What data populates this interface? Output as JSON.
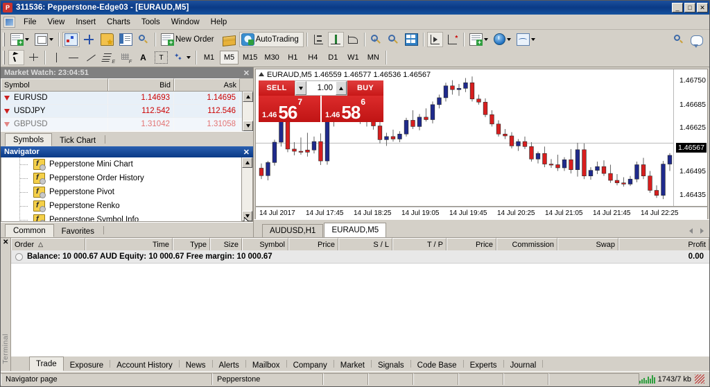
{
  "window": {
    "title": "311536: Pepperstone-Edge03 - [EURAUD,M5]",
    "app_icon": "P",
    "minimize": "_",
    "maximize": "□",
    "close": "✕"
  },
  "menu": [
    "File",
    "View",
    "Insert",
    "Charts",
    "Tools",
    "Window",
    "Help"
  ],
  "toolbar_main": {
    "new_chart": "new-chart-icon",
    "profiles": "profiles-icon",
    "market_watch": "market-watch-icon",
    "data_window": "data-window-icon",
    "navigator": "navigator-icon",
    "terminal": "terminal-icon",
    "strategy_tester": "strategy-tester-icon",
    "new_order_label": "New Order",
    "mqlcommunity": "mail-icon",
    "autotrading_label": "AutoTrading",
    "bar_chart": "bar-chart-icon",
    "candle_chart": "candlestick-chart-icon",
    "line_chart": "line-chart-icon",
    "zoom_in": "zoom-in-icon",
    "zoom_out": "zoom-out-icon",
    "tile_windows": "tile-windows-icon",
    "chart_shift": "chart-shift-icon",
    "auto_scroll": "auto-scroll-icon",
    "indicators": "indicators-icon",
    "periods": "periods-clock-icon",
    "templates": "templates-icon",
    "search": "search-icon",
    "chat": "chat-icon"
  },
  "toolbar_draw": {
    "cursor": "cursor-icon",
    "crosshair": "crosshair-icon",
    "vertical_line": "vertical-line-icon",
    "horizontal_line": "horizontal-line-icon",
    "trendline": "trendline-icon",
    "fibonacci": "fibonacci-icon",
    "shapes": "shapes-icon",
    "text_label": "text-label-icon",
    "text_box": "text-box-icon",
    "objects": "objects-icon"
  },
  "timeframes": {
    "items": [
      "M1",
      "M5",
      "M15",
      "M30",
      "H1",
      "H4",
      "D1",
      "W1",
      "MN"
    ],
    "selected": "M5"
  },
  "market_watch": {
    "title": "Market Watch: 23:04:51",
    "close": "✕",
    "columns": [
      "Symbol",
      "Bid",
      "Ask"
    ],
    "rows": [
      {
        "symbol": "EURUSD",
        "bid": "1.14693",
        "ask": "1.14695"
      },
      {
        "symbol": "USDJPY",
        "bid": "112.542",
        "ask": "112.546"
      },
      {
        "symbol": "GBPUSD",
        "bid": "1.31042",
        "ask": "1.31058"
      }
    ],
    "tabs": [
      "Symbols",
      "Tick Chart"
    ],
    "selected_tab": "Symbols"
  },
  "navigator": {
    "title": "Navigator",
    "close": "✕",
    "items": [
      "Pepperstone Mini Chart",
      "Pepperstone Order History",
      "Pepperstone Pivot",
      "Pepperstone Renko",
      "Pepperstone Symbol Info"
    ],
    "tabs": [
      "Common",
      "Favorites"
    ],
    "selected_tab": "Common"
  },
  "chart": {
    "header": "EURAUD,M5  1.46559 1.46577 1.46536 1.46567",
    "symbol": "EURAUD",
    "period": "M5",
    "ohlc": {
      "open": "1.46559",
      "high": "1.46577",
      "low": "1.46536",
      "close": "1.46567"
    },
    "one_click_trading": {
      "sell_label": "SELL",
      "buy_label": "BUY",
      "volume": "1.00",
      "sell_big_prefix": "1.46",
      "sell_big": "56",
      "sell_sup": "7",
      "buy_big_prefix": "1.46",
      "buy_big": "58",
      "buy_sup": "6",
      "dropdown_icon": "chevron-down-icon",
      "spinner_icon": "chevron-up-icon"
    },
    "price_labels": [
      "1.46750",
      "1.46685",
      "1.46625",
      "1.46495",
      "1.46435"
    ],
    "current_price": "1.46567",
    "time_labels": [
      "14 Jul 2017",
      "14 Jul 17:45",
      "14 Jul 18:25",
      "14 Jul 19:05",
      "14 Jul 19:45",
      "14 Jul 20:25",
      "14 Jul 21:05",
      "14 Jul 21:45",
      "14 Jul 22:25"
    ],
    "tabs": [
      "AUDUSD,H1",
      "EURAUD,M5"
    ],
    "selected_tab": "EURAUD,M5",
    "scroll_left_icon": "chevron-left-icon",
    "scroll_right_icon": "chevron-right-icon"
  },
  "chart_data": {
    "type": "candlestick",
    "title": "EURAUD,M5",
    "xlabel": "",
    "ylabel": "",
    "ylim": [
      1.464,
      1.4679
    ],
    "bull_color": "#1f2a8c",
    "bear_color": "#d81e1e",
    "candles": [
      {
        "o": 1.46487,
        "h": 1.46502,
        "l": 1.46452,
        "c": 1.46463,
        "dir": "down"
      },
      {
        "o": 1.46463,
        "h": 1.4651,
        "l": 1.46448,
        "c": 1.46505,
        "dir": "up"
      },
      {
        "o": 1.46505,
        "h": 1.46578,
        "l": 1.46495,
        "c": 1.4657,
        "dir": "up"
      },
      {
        "o": 1.4657,
        "h": 1.46645,
        "l": 1.46556,
        "c": 1.46638,
        "dir": "up"
      },
      {
        "o": 1.4664,
        "h": 1.46652,
        "l": 1.46538,
        "c": 1.46548,
        "dir": "down"
      },
      {
        "o": 1.46548,
        "h": 1.4657,
        "l": 1.46528,
        "c": 1.46541,
        "dir": "down"
      },
      {
        "o": 1.46541,
        "h": 1.46585,
        "l": 1.4653,
        "c": 1.46538,
        "dir": "down"
      },
      {
        "o": 1.46538,
        "h": 1.466,
        "l": 1.46524,
        "c": 1.46545,
        "dir": "down"
      },
      {
        "o": 1.46545,
        "h": 1.46588,
        "l": 1.46534,
        "c": 1.46572,
        "dir": "up"
      },
      {
        "o": 1.46572,
        "h": 1.46598,
        "l": 1.46497,
        "c": 1.4651,
        "dir": "down"
      },
      {
        "o": 1.4651,
        "h": 1.4666,
        "l": 1.46498,
        "c": 1.46648,
        "dir": "up"
      },
      {
        "o": 1.46648,
        "h": 1.46678,
        "l": 1.4662,
        "c": 1.46665,
        "dir": "up"
      },
      {
        "o": 1.46665,
        "h": 1.4669,
        "l": 1.4665,
        "c": 1.46672,
        "dir": "up"
      },
      {
        "o": 1.46672,
        "h": 1.46688,
        "l": 1.4664,
        "c": 1.46655,
        "dir": "down"
      },
      {
        "o": 1.46655,
        "h": 1.46692,
        "l": 1.46645,
        "c": 1.46678,
        "dir": "up"
      },
      {
        "o": 1.46678,
        "h": 1.467,
        "l": 1.46628,
        "c": 1.4664,
        "dir": "down"
      },
      {
        "o": 1.4664,
        "h": 1.46688,
        "l": 1.4662,
        "c": 1.46668,
        "dir": "up"
      },
      {
        "o": 1.46668,
        "h": 1.46695,
        "l": 1.4661,
        "c": 1.46622,
        "dir": "down"
      },
      {
        "o": 1.46622,
        "h": 1.4664,
        "l": 1.46566,
        "c": 1.46578,
        "dir": "down"
      },
      {
        "o": 1.46578,
        "h": 1.466,
        "l": 1.46558,
        "c": 1.46588,
        "dir": "up"
      },
      {
        "o": 1.46588,
        "h": 1.4661,
        "l": 1.46572,
        "c": 1.4658,
        "dir": "down"
      },
      {
        "o": 1.4658,
        "h": 1.46605,
        "l": 1.4657,
        "c": 1.46596,
        "dir": "up"
      },
      {
        "o": 1.46596,
        "h": 1.46648,
        "l": 1.46588,
        "c": 1.4664,
        "dir": "up"
      },
      {
        "o": 1.4664,
        "h": 1.46672,
        "l": 1.46612,
        "c": 1.4662,
        "dir": "down"
      },
      {
        "o": 1.4662,
        "h": 1.4666,
        "l": 1.46608,
        "c": 1.4665,
        "dir": "up"
      },
      {
        "o": 1.4665,
        "h": 1.46678,
        "l": 1.46636,
        "c": 1.46642,
        "dir": "down"
      },
      {
        "o": 1.46642,
        "h": 1.467,
        "l": 1.4663,
        "c": 1.4669,
        "dir": "up"
      },
      {
        "o": 1.4669,
        "h": 1.46722,
        "l": 1.46678,
        "c": 1.46712,
        "dir": "up"
      },
      {
        "o": 1.46712,
        "h": 1.4676,
        "l": 1.467,
        "c": 1.4675,
        "dir": "up"
      },
      {
        "o": 1.4675,
        "h": 1.46768,
        "l": 1.46722,
        "c": 1.46738,
        "dir": "down"
      },
      {
        "o": 1.46738,
        "h": 1.46756,
        "l": 1.46718,
        "c": 1.46742,
        "dir": "up"
      },
      {
        "o": 1.46742,
        "h": 1.46775,
        "l": 1.4673,
        "c": 1.4676,
        "dir": "up"
      },
      {
        "o": 1.4676,
        "h": 1.4678,
        "l": 1.467,
        "c": 1.46708,
        "dir": "down"
      },
      {
        "o": 1.46708,
        "h": 1.46722,
        "l": 1.4669,
        "c": 1.46698,
        "dir": "down"
      },
      {
        "o": 1.46698,
        "h": 1.4671,
        "l": 1.4665,
        "c": 1.46658,
        "dir": "down"
      },
      {
        "o": 1.46658,
        "h": 1.46672,
        "l": 1.4662,
        "c": 1.46628,
        "dir": "down"
      },
      {
        "o": 1.46628,
        "h": 1.4664,
        "l": 1.46588,
        "c": 1.46596,
        "dir": "down"
      },
      {
        "o": 1.46596,
        "h": 1.46612,
        "l": 1.4658,
        "c": 1.4659,
        "dir": "down"
      },
      {
        "o": 1.4659,
        "h": 1.46602,
        "l": 1.4655,
        "c": 1.46558,
        "dir": "down"
      },
      {
        "o": 1.46558,
        "h": 1.4658,
        "l": 1.46542,
        "c": 1.46572,
        "dir": "up"
      },
      {
        "o": 1.46572,
        "h": 1.46588,
        "l": 1.46548,
        "c": 1.46556,
        "dir": "down"
      },
      {
        "o": 1.46556,
        "h": 1.4657,
        "l": 1.46508,
        "c": 1.46516,
        "dir": "down"
      },
      {
        "o": 1.46516,
        "h": 1.4654,
        "l": 1.46502,
        "c": 1.46534,
        "dir": "up"
      },
      {
        "o": 1.46534,
        "h": 1.46556,
        "l": 1.4649,
        "c": 1.465,
        "dir": "down"
      },
      {
        "o": 1.465,
        "h": 1.46516,
        "l": 1.46488,
        "c": 1.46498,
        "dir": "down"
      },
      {
        "o": 1.46498,
        "h": 1.4653,
        "l": 1.46478,
        "c": 1.46488,
        "dir": "down"
      },
      {
        "o": 1.46488,
        "h": 1.46522,
        "l": 1.46478,
        "c": 1.46514,
        "dir": "up"
      },
      {
        "o": 1.46514,
        "h": 1.46548,
        "l": 1.4647,
        "c": 1.46482,
        "dir": "down"
      },
      {
        "o": 1.46482,
        "h": 1.46568,
        "l": 1.4646,
        "c": 1.46546,
        "dir": "up"
      },
      {
        "o": 1.46546,
        "h": 1.46566,
        "l": 1.46452,
        "c": 1.46462,
        "dir": "down"
      },
      {
        "o": 1.46462,
        "h": 1.4649,
        "l": 1.4645,
        "c": 1.4648,
        "dir": "up"
      },
      {
        "o": 1.4648,
        "h": 1.46508,
        "l": 1.46468,
        "c": 1.46492,
        "dir": "up"
      },
      {
        "o": 1.46492,
        "h": 1.46512,
        "l": 1.46462,
        "c": 1.4647,
        "dir": "down"
      },
      {
        "o": 1.4647,
        "h": 1.46498,
        "l": 1.4644,
        "c": 1.46448,
        "dir": "down"
      },
      {
        "o": 1.46448,
        "h": 1.46468,
        "l": 1.46432,
        "c": 1.4644,
        "dir": "down"
      },
      {
        "o": 1.4644,
        "h": 1.46458,
        "l": 1.46428,
        "c": 1.46436,
        "dir": "down"
      },
      {
        "o": 1.46436,
        "h": 1.46462,
        "l": 1.4643,
        "c": 1.46452,
        "dir": "up"
      },
      {
        "o": 1.46452,
        "h": 1.46508,
        "l": 1.46442,
        "c": 1.46498,
        "dir": "up"
      },
      {
        "o": 1.46498,
        "h": 1.4652,
        "l": 1.46452,
        "c": 1.46462,
        "dir": "down"
      },
      {
        "o": 1.46462,
        "h": 1.46478,
        "l": 1.46408,
        "c": 1.46416,
        "dir": "down"
      },
      {
        "o": 1.46416,
        "h": 1.46432,
        "l": 1.46392,
        "c": 1.464,
        "dir": "down"
      },
      {
        "o": 1.464,
        "h": 1.4651,
        "l": 1.46388,
        "c": 1.465,
        "dir": "up"
      },
      {
        "o": 1.465,
        "h": 1.46535,
        "l": 1.46478,
        "c": 1.46528,
        "dir": "up"
      }
    ]
  },
  "terminal": {
    "close": "✕",
    "side_label": "Terminal",
    "columns": [
      "Order",
      "Time",
      "Type",
      "Size",
      "Symbol",
      "Price",
      "S / L",
      "T / P",
      "Price",
      "Commission",
      "Swap",
      "Profit"
    ],
    "sort_indicator": "△",
    "balance_row": {
      "text": "Balance: 10 000.67 AUD  Equity: 10 000.67  Free margin: 10 000.67",
      "balance": "10 000.67",
      "currency": "AUD",
      "equity": "10 000.67",
      "free_margin": "10 000.67",
      "profit": "0.00"
    },
    "tabs": [
      "Trade",
      "Exposure",
      "Account History",
      "News",
      "Alerts",
      "Mailbox",
      "Company",
      "Market",
      "Signals",
      "Code Base",
      "Experts",
      "Journal"
    ],
    "selected_tab": "Trade"
  },
  "statusbar": {
    "hint": "Navigator page",
    "server": "Pepperstone",
    "traffic": "1743/7 kb",
    "signal_icon": "signal-bars-icon",
    "resize_icon": "resize-grip-icon"
  }
}
